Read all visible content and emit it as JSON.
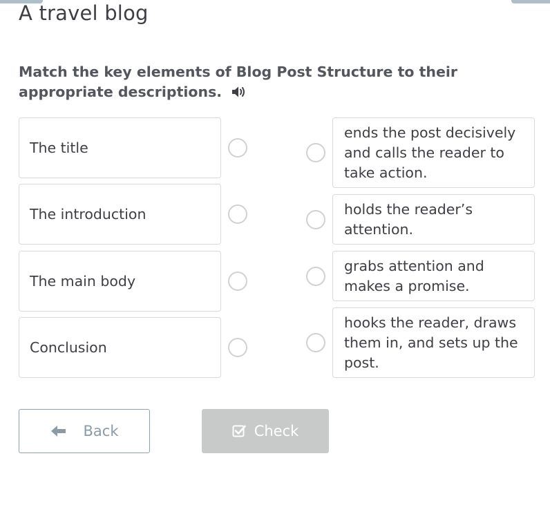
{
  "page": {
    "title": "A travel blog"
  },
  "question": {
    "text": "Match the key elements of Blog Post Structure to their appropriate descriptions.",
    "audio_icon": "speaker-icon"
  },
  "left_items": [
    {
      "label": "The title"
    },
    {
      "label": "The introduction"
    },
    {
      "label": "The main body"
    },
    {
      "label": "Conclusion"
    }
  ],
  "right_items": [
    {
      "label": "ends the post decisively and calls the reader to take action."
    },
    {
      "label": "holds the reader’s attention."
    },
    {
      "label": "grabs attention and makes a promise."
    },
    {
      "label": "hooks the reader, draws them in, and sets up the post."
    }
  ],
  "buttons": {
    "back_label": "Back",
    "back_icon": "arrow-left-icon",
    "check_label": "Check",
    "check_icon": "checkbox-icon"
  },
  "colors": {
    "card_border": "#d9dadc",
    "radio_border": "#cfd2d3",
    "back_border": "#8fa3ad",
    "back_text": "#8a9ba5",
    "check_disabled_bg": "#c8c9c9"
  }
}
